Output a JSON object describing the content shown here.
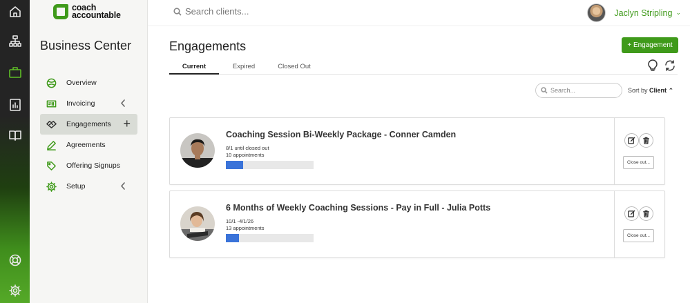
{
  "brand": {
    "logo_line1": "coach",
    "logo_line2": "accountable"
  },
  "rail": {
    "icons": [
      "home-icon",
      "org-chart-icon",
      "briefcase-icon",
      "report-icon",
      "book-icon",
      "help-icon",
      "settings-icon"
    ],
    "active": "briefcase-icon"
  },
  "sidebar": {
    "title": "Business Center",
    "items": [
      {
        "label": "Overview",
        "icon": "overview-icon"
      },
      {
        "label": "Invoicing",
        "icon": "invoice-icon"
      },
      {
        "label": "Engagements",
        "icon": "handshake-icon"
      },
      {
        "label": "Agreements",
        "icon": "pen-icon"
      },
      {
        "label": "Offering Signups",
        "icon": "tag-icon"
      },
      {
        "label": "Setup",
        "icon": "gear-icon"
      }
    ]
  },
  "topbar": {
    "search_placeholder": "Search clients...",
    "user_name": "Jaclyn Stripling"
  },
  "main": {
    "title": "Engagements",
    "new_button": "+ Engagement",
    "tabs": [
      {
        "label": "Current"
      },
      {
        "label": "Expired"
      },
      {
        "label": "Closed Out"
      }
    ],
    "search_placeholder": "Search...",
    "sort_label": "Sort by",
    "sort_value": "Client"
  },
  "engagements": [
    {
      "title": "Coaching Session Bi-Weekly Package - Conner Camden",
      "dates": "8/1 until closed out",
      "appointments": "10 appointments",
      "progress": 0.2,
      "close_label": "Close out..."
    },
    {
      "title": "6 Months of Weekly Coaching Sessions - Pay in Full - Julia Potts",
      "dates": "10/1 -4/1/26",
      "appointments": "13 appointments",
      "progress": 0.15,
      "close_label": "Close out..."
    }
  ],
  "colors": {
    "brand_green": "#3f9a1a",
    "progress_blue": "#3a73d9"
  }
}
